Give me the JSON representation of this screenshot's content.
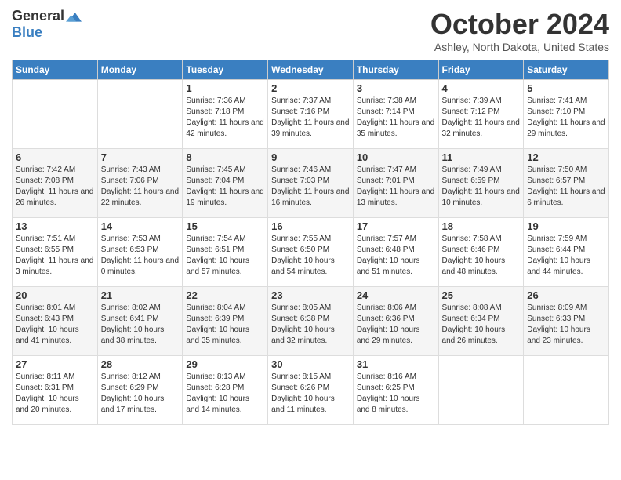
{
  "logo": {
    "general": "General",
    "blue": "Blue"
  },
  "header": {
    "month_title": "October 2024",
    "location": "Ashley, North Dakota, United States"
  },
  "days_of_week": [
    "Sunday",
    "Monday",
    "Tuesday",
    "Wednesday",
    "Thursday",
    "Friday",
    "Saturday"
  ],
  "weeks": [
    [
      {
        "day": "",
        "sunrise": "",
        "sunset": "",
        "daylight": ""
      },
      {
        "day": "",
        "sunrise": "",
        "sunset": "",
        "daylight": ""
      },
      {
        "day": "1",
        "sunrise": "Sunrise: 7:36 AM",
        "sunset": "Sunset: 7:18 PM",
        "daylight": "Daylight: 11 hours and 42 minutes."
      },
      {
        "day": "2",
        "sunrise": "Sunrise: 7:37 AM",
        "sunset": "Sunset: 7:16 PM",
        "daylight": "Daylight: 11 hours and 39 minutes."
      },
      {
        "day": "3",
        "sunrise": "Sunrise: 7:38 AM",
        "sunset": "Sunset: 7:14 PM",
        "daylight": "Daylight: 11 hours and 35 minutes."
      },
      {
        "day": "4",
        "sunrise": "Sunrise: 7:39 AM",
        "sunset": "Sunset: 7:12 PM",
        "daylight": "Daylight: 11 hours and 32 minutes."
      },
      {
        "day": "5",
        "sunrise": "Sunrise: 7:41 AM",
        "sunset": "Sunset: 7:10 PM",
        "daylight": "Daylight: 11 hours and 29 minutes."
      }
    ],
    [
      {
        "day": "6",
        "sunrise": "Sunrise: 7:42 AM",
        "sunset": "Sunset: 7:08 PM",
        "daylight": "Daylight: 11 hours and 26 minutes."
      },
      {
        "day": "7",
        "sunrise": "Sunrise: 7:43 AM",
        "sunset": "Sunset: 7:06 PM",
        "daylight": "Daylight: 11 hours and 22 minutes."
      },
      {
        "day": "8",
        "sunrise": "Sunrise: 7:45 AM",
        "sunset": "Sunset: 7:04 PM",
        "daylight": "Daylight: 11 hours and 19 minutes."
      },
      {
        "day": "9",
        "sunrise": "Sunrise: 7:46 AM",
        "sunset": "Sunset: 7:03 PM",
        "daylight": "Daylight: 11 hours and 16 minutes."
      },
      {
        "day": "10",
        "sunrise": "Sunrise: 7:47 AM",
        "sunset": "Sunset: 7:01 PM",
        "daylight": "Daylight: 11 hours and 13 minutes."
      },
      {
        "day": "11",
        "sunrise": "Sunrise: 7:49 AM",
        "sunset": "Sunset: 6:59 PM",
        "daylight": "Daylight: 11 hours and 10 minutes."
      },
      {
        "day": "12",
        "sunrise": "Sunrise: 7:50 AM",
        "sunset": "Sunset: 6:57 PM",
        "daylight": "Daylight: 11 hours and 6 minutes."
      }
    ],
    [
      {
        "day": "13",
        "sunrise": "Sunrise: 7:51 AM",
        "sunset": "Sunset: 6:55 PM",
        "daylight": "Daylight: 11 hours and 3 minutes."
      },
      {
        "day": "14",
        "sunrise": "Sunrise: 7:53 AM",
        "sunset": "Sunset: 6:53 PM",
        "daylight": "Daylight: 11 hours and 0 minutes."
      },
      {
        "day": "15",
        "sunrise": "Sunrise: 7:54 AM",
        "sunset": "Sunset: 6:51 PM",
        "daylight": "Daylight: 10 hours and 57 minutes."
      },
      {
        "day": "16",
        "sunrise": "Sunrise: 7:55 AM",
        "sunset": "Sunset: 6:50 PM",
        "daylight": "Daylight: 10 hours and 54 minutes."
      },
      {
        "day": "17",
        "sunrise": "Sunrise: 7:57 AM",
        "sunset": "Sunset: 6:48 PM",
        "daylight": "Daylight: 10 hours and 51 minutes."
      },
      {
        "day": "18",
        "sunrise": "Sunrise: 7:58 AM",
        "sunset": "Sunset: 6:46 PM",
        "daylight": "Daylight: 10 hours and 48 minutes."
      },
      {
        "day": "19",
        "sunrise": "Sunrise: 7:59 AM",
        "sunset": "Sunset: 6:44 PM",
        "daylight": "Daylight: 10 hours and 44 minutes."
      }
    ],
    [
      {
        "day": "20",
        "sunrise": "Sunrise: 8:01 AM",
        "sunset": "Sunset: 6:43 PM",
        "daylight": "Daylight: 10 hours and 41 minutes."
      },
      {
        "day": "21",
        "sunrise": "Sunrise: 8:02 AM",
        "sunset": "Sunset: 6:41 PM",
        "daylight": "Daylight: 10 hours and 38 minutes."
      },
      {
        "day": "22",
        "sunrise": "Sunrise: 8:04 AM",
        "sunset": "Sunset: 6:39 PM",
        "daylight": "Daylight: 10 hours and 35 minutes."
      },
      {
        "day": "23",
        "sunrise": "Sunrise: 8:05 AM",
        "sunset": "Sunset: 6:38 PM",
        "daylight": "Daylight: 10 hours and 32 minutes."
      },
      {
        "day": "24",
        "sunrise": "Sunrise: 8:06 AM",
        "sunset": "Sunset: 6:36 PM",
        "daylight": "Daylight: 10 hours and 29 minutes."
      },
      {
        "day": "25",
        "sunrise": "Sunrise: 8:08 AM",
        "sunset": "Sunset: 6:34 PM",
        "daylight": "Daylight: 10 hours and 26 minutes."
      },
      {
        "day": "26",
        "sunrise": "Sunrise: 8:09 AM",
        "sunset": "Sunset: 6:33 PM",
        "daylight": "Daylight: 10 hours and 23 minutes."
      }
    ],
    [
      {
        "day": "27",
        "sunrise": "Sunrise: 8:11 AM",
        "sunset": "Sunset: 6:31 PM",
        "daylight": "Daylight: 10 hours and 20 minutes."
      },
      {
        "day": "28",
        "sunrise": "Sunrise: 8:12 AM",
        "sunset": "Sunset: 6:29 PM",
        "daylight": "Daylight: 10 hours and 17 minutes."
      },
      {
        "day": "29",
        "sunrise": "Sunrise: 8:13 AM",
        "sunset": "Sunset: 6:28 PM",
        "daylight": "Daylight: 10 hours and 14 minutes."
      },
      {
        "day": "30",
        "sunrise": "Sunrise: 8:15 AM",
        "sunset": "Sunset: 6:26 PM",
        "daylight": "Daylight: 10 hours and 11 minutes."
      },
      {
        "day": "31",
        "sunrise": "Sunrise: 8:16 AM",
        "sunset": "Sunset: 6:25 PM",
        "daylight": "Daylight: 10 hours and 8 minutes."
      },
      {
        "day": "",
        "sunrise": "",
        "sunset": "",
        "daylight": ""
      },
      {
        "day": "",
        "sunrise": "",
        "sunset": "",
        "daylight": ""
      }
    ]
  ]
}
